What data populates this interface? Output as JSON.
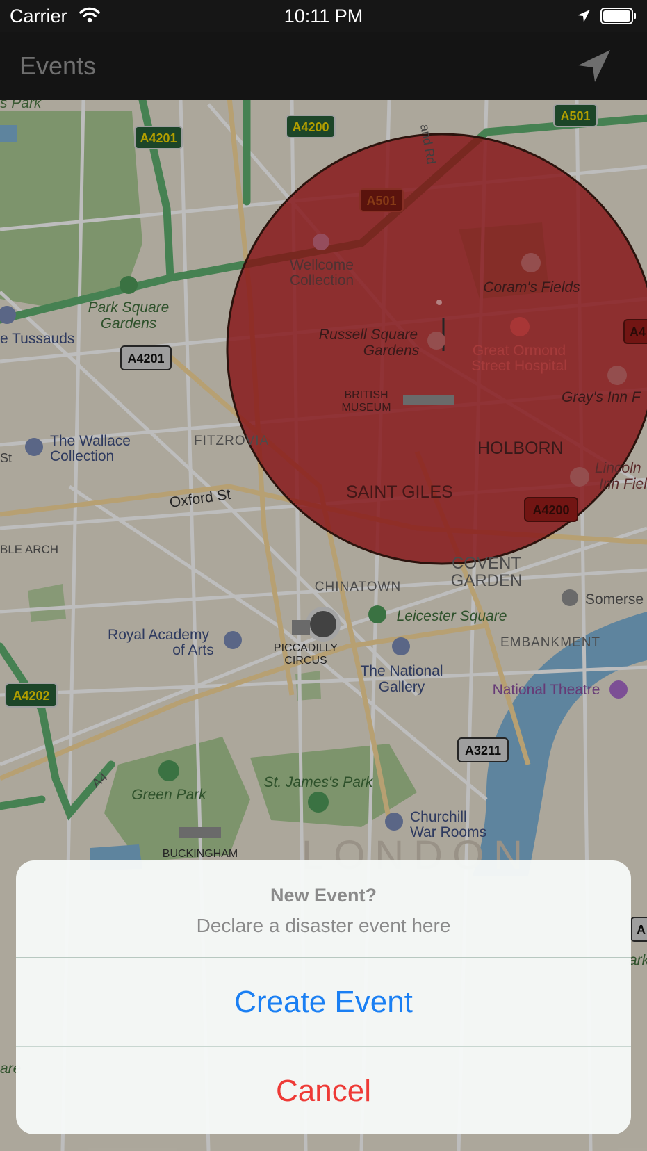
{
  "status_bar": {
    "carrier": "Carrier",
    "time": "10:11 PM",
    "icons": [
      "wifi-icon",
      "location-arrow-icon",
      "battery-icon"
    ]
  },
  "nav_bar": {
    "title": "Events",
    "locate_icon": "location-arrow-icon"
  },
  "map": {
    "roads": {
      "a4201_top": "A4201",
      "a4200_top": "A4200",
      "a501_top": "A501",
      "a501_center": "A501",
      "a4201_left": "A4201",
      "a4200_right": "A4200",
      "a3211": "A3211",
      "a4202": "A4202",
      "a4_right": "A4",
      "a_right2": "A",
      "a4_diag": "A4"
    },
    "labels": {
      "park": "s Park",
      "wellcome1": "Wellcome",
      "wellcome2": "Collection",
      "corams": "Coram's Fields",
      "parksquare1": "Park Square",
      "parksquare2": "Gardens",
      "tussauds": "e Tussauds",
      "russell1": "Russell Square",
      "russell2": "Gardens",
      "gosh1": "Great Ormond",
      "gosh2": "Street Hospital",
      "grays": "Gray's Inn F",
      "british1": "BRITISH",
      "british2": "MUSEUM",
      "wallace1": "The Wallace",
      "wallace2": "Collection",
      "fitzrovia": "FITZROVIA",
      "holborn": "HOLBORN",
      "lincoln1": "Lincoln",
      "lincoln2": "Inn Fiel",
      "oxford": "Oxford St",
      "saintgiles": "SAINT GILES",
      "blearch": "BLE ARCH",
      "covent1": "COVENT",
      "covent2": "GARDEN",
      "chinatown": "CHINATOWN",
      "somerset": "Somerse",
      "leicester": "Leicester Square",
      "royal1": "Royal Academy",
      "royal2": "of Arts",
      "piccadilly1": "PICCADILLY",
      "piccadilly2": "CIRCUS",
      "embankment": "EMBANKMENT",
      "national1": "The National",
      "national2": "Gallery",
      "natheatre": "National Theatre",
      "greenpark": "Green Park",
      "stjames": "St. James's Park",
      "churchill1": "Churchill",
      "churchill2": "War Rooms",
      "buckingham": "BUCKINGHAM",
      "london": "LONDON",
      "st": "St",
      "andrd": "and Rd",
      "ark": "ark",
      "are": "are"
    },
    "colors": {
      "region_fill": "#b4181c",
      "water": "#4b8fb0",
      "park": "#6a8a5c",
      "major_road": "#58b26b"
    }
  },
  "action_sheet": {
    "title": "New Event?",
    "message": "Declare a disaster event here",
    "create_label": "Create Event",
    "cancel_label": "Cancel",
    "colors": {
      "create": "#1a7ff3",
      "cancel": "#ee3a36"
    }
  }
}
